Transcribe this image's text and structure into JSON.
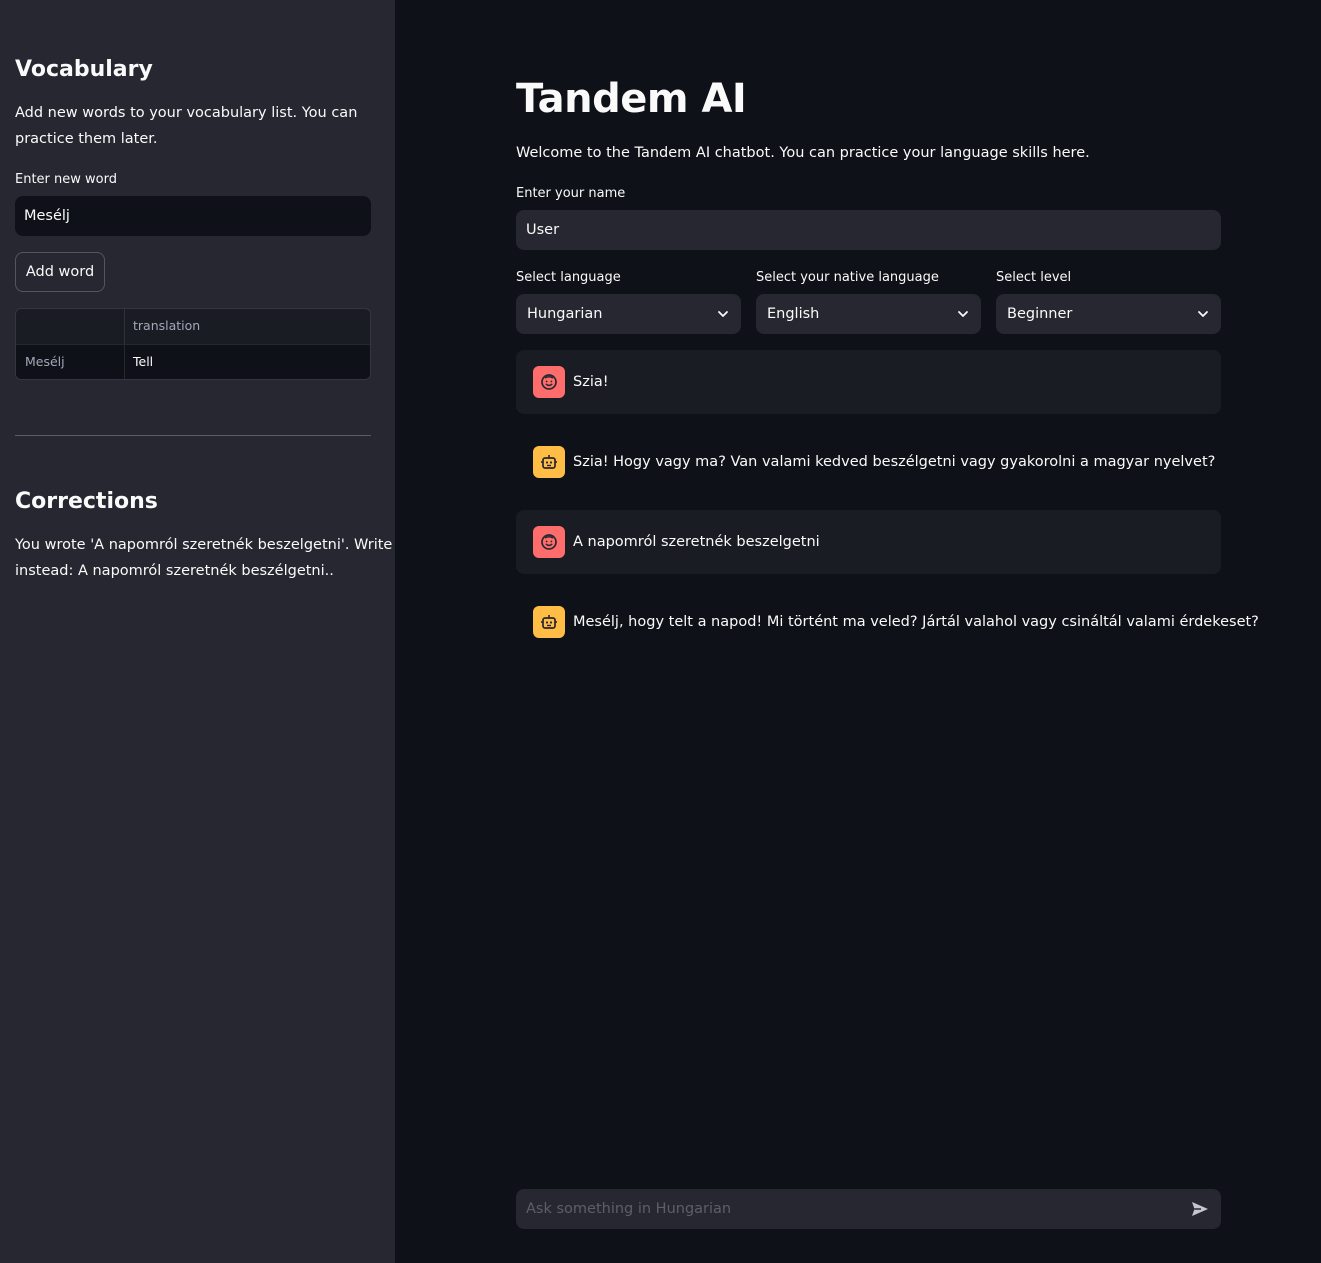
{
  "sidebar": {
    "vocab_heading": "Vocabulary",
    "vocab_desc_line1": "Add new words to your vocabulary list. You can",
    "vocab_desc_line2": "practice them later.",
    "word_label": "Enter new word",
    "word_value": "Mesélj",
    "add_button": "Add word",
    "table": {
      "header_col1": "",
      "header_col2": "translation",
      "rows": [
        {
          "word": "Mesélj",
          "translation": "Tell"
        }
      ]
    },
    "corrections_heading": "Corrections",
    "corrections_line1": "You wrote 'A napomról szeretnék beszelgetni'. Write",
    "corrections_line2": "instead: A napomról szeretnék beszélgetni.."
  },
  "main": {
    "title": "Tandem AI",
    "welcome": "Welcome to the Tandem AI chatbot. You can practice your language skills here.",
    "name_label": "Enter your name",
    "name_value": "User",
    "language_label": "Select language",
    "language_value": "Hungarian",
    "native_label": "Select your native language",
    "native_value": "English",
    "level_label": "Select level",
    "level_value": "Beginner",
    "messages": [
      {
        "role": "user",
        "text": "Szia!"
      },
      {
        "role": "assistant",
        "text": "Szia! Hogy vagy ma? Van valami kedved beszélgetni vagy gyakorolni a magyar nyelvet?"
      },
      {
        "role": "user",
        "text": "A napomról szeretnék beszelgetni"
      },
      {
        "role": "assistant",
        "text": "Mesélj, hogy telt a napod! Mi történt ma veled? Jártál valahol vagy csináltál valami érdekeset?"
      }
    ],
    "chat_placeholder": "Ask something in Hungarian"
  },
  "colors": {
    "sidebar_bg": "#262730",
    "main_bg": "#0e1117",
    "user_avatar": "#ff6c6c",
    "bot_avatar": "#ffbd45"
  },
  "icons": {
    "user_avatar": "smile-face-icon",
    "bot_avatar": "robot-icon",
    "select_arrow": "chevron-down-icon",
    "send": "send-icon"
  }
}
